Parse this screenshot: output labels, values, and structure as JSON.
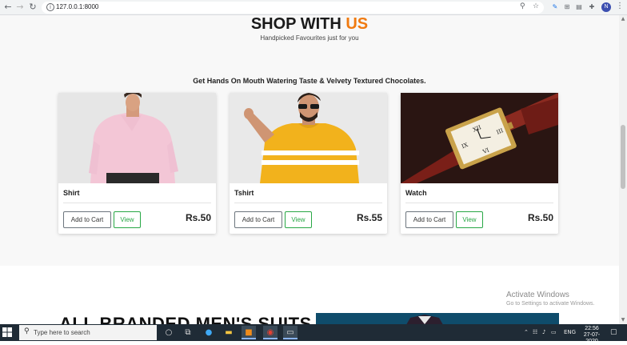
{
  "browser": {
    "url": "127.0.0.1:8000",
    "profile_initial": "N"
  },
  "page": {
    "heading_main": "SHOP WITH ",
    "heading_accent": "US",
    "subheading": "Handpicked Favourites just for you",
    "tagline": "Get Hands On Mouth Watering Taste & Velvety Textured Chocolates.",
    "accent_color": "#f07a10",
    "products": [
      {
        "title": "Shirt",
        "price": "Rs.50",
        "cart_label": "Add to Cart",
        "view_label": "View"
      },
      {
        "title": "Tshirt",
        "price": "Rs.55",
        "cart_label": "Add to Cart",
        "view_label": "View"
      },
      {
        "title": "Watch",
        "price": "Rs.50",
        "cart_label": "Add to Cart",
        "view_label": "View"
      }
    ],
    "suits_title": "ALL BRANDED MEN'S SUITS"
  },
  "watermark": {
    "line1": "Activate Windows",
    "line2": "Go to Settings to activate Windows."
  },
  "taskbar": {
    "search_placeholder": "Type here to search",
    "language": "ENG",
    "time": "22:56",
    "date": "27-07-2020"
  }
}
